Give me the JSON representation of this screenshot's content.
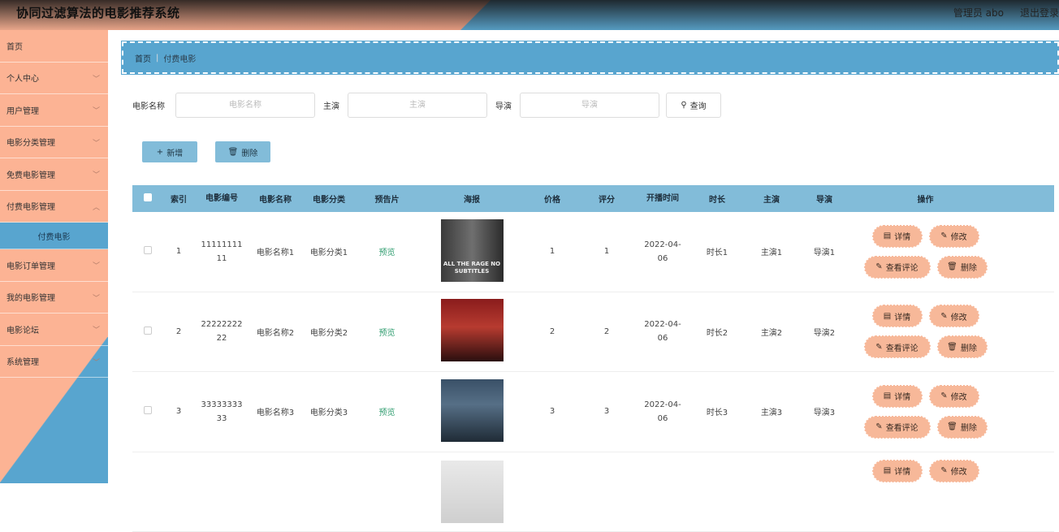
{
  "header": {
    "app_title": "协同过滤算法的电影推荐系统",
    "user": "管理员 abo",
    "logout": "退出登录"
  },
  "sidebar": {
    "items": [
      {
        "label": "首页",
        "has_children": false
      },
      {
        "label": "个人中心",
        "has_children": true
      },
      {
        "label": "用户管理",
        "has_children": true
      },
      {
        "label": "电影分类管理",
        "has_children": true
      },
      {
        "label": "免费电影管理",
        "has_children": true
      },
      {
        "label": "付费电影管理",
        "has_children": true
      },
      {
        "label": "付费电影",
        "sub": true
      },
      {
        "label": "电影订单管理",
        "has_children": true
      },
      {
        "label": "我的电影管理",
        "has_children": true
      },
      {
        "label": "电影论坛",
        "has_children": true
      },
      {
        "label": "系统管理",
        "has_children": true
      }
    ]
  },
  "breadcrumb": {
    "home": "首页",
    "current": "付费电影"
  },
  "search": {
    "name_label": "电影名称",
    "name_placeholder": "电影名称",
    "star_label": "主演",
    "star_placeholder": "主演",
    "director_label": "导演",
    "director_placeholder": "导演",
    "button": "查询",
    "button_icon": "search-icon"
  },
  "actions": {
    "add": "新增",
    "delete": "删除"
  },
  "table": {
    "headers": {
      "index": "索引",
      "no": "电影编号",
      "name": "电影名称",
      "category": "电影分类",
      "preview": "预告片",
      "poster": "海报",
      "price": "价格",
      "score": "评分",
      "date": "开播时间",
      "duration": "时长",
      "star": "主演",
      "director": "导演",
      "ops": "操作"
    },
    "rows": [
      {
        "index": "1",
        "no": "1111111111",
        "name": "电影名称1",
        "category": "电影分类1",
        "preview": "预览",
        "poster_text": "ALL THE RAGE NO SUBTITLES",
        "price": "1",
        "score": "1",
        "date": "2022-04-06",
        "duration": "时长1",
        "star": "主演1",
        "director": "导演1"
      },
      {
        "index": "2",
        "no": "2222222222",
        "name": "电影名称2",
        "category": "电影分类2",
        "preview": "预览",
        "poster_text": "",
        "price": "2",
        "score": "2",
        "date": "2022-04-06",
        "duration": "时长2",
        "star": "主演2",
        "director": "导演2"
      },
      {
        "index": "3",
        "no": "3333333333",
        "name": "电影名称3",
        "category": "电影分类3",
        "preview": "预览",
        "poster_text": "",
        "price": "3",
        "score": "3",
        "date": "2022-04-06",
        "duration": "时长3",
        "star": "主演3",
        "director": "导演3"
      },
      {
        "index": "",
        "no": "",
        "name": "",
        "category": "",
        "preview": "",
        "poster_text": "",
        "price": "",
        "score": "",
        "date": "",
        "duration": "",
        "star": "",
        "director": ""
      }
    ],
    "row_actions": {
      "detail": "详情",
      "edit": "修改",
      "comments": "查看评论",
      "delete": "删除"
    }
  },
  "colors": {
    "accent_blue": "#58a5cf",
    "table_header": "#82bcd9",
    "salmon": "#fcb394",
    "op_button": "#f7b899"
  }
}
